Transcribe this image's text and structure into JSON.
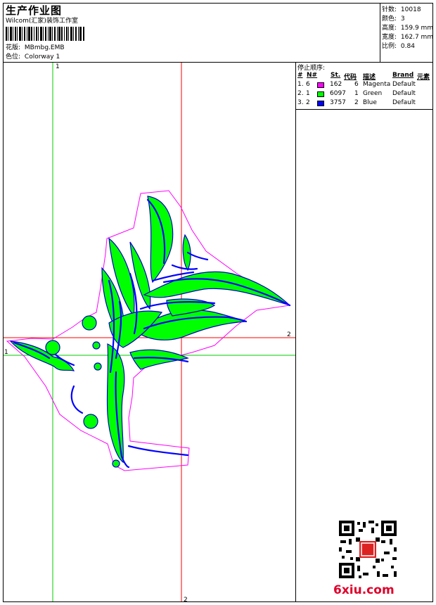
{
  "header": {
    "title": "生产作业图",
    "company": "Wilcom(汇家)装饰工作室",
    "design_label": "花版:",
    "design_value": "MBmbg.EMB",
    "colorway_label": "色位:",
    "colorway_value": "Colorway 1"
  },
  "stats": [
    {
      "label": "针数:",
      "value": "10018"
    },
    {
      "label": "颜色:",
      "value": "3"
    },
    {
      "label": "高度:",
      "value": "159.9 mm"
    },
    {
      "label": "宽度:",
      "value": "162.7 mm"
    },
    {
      "label": "比例:",
      "value": "0.84"
    }
  ],
  "stop_sequence": {
    "title": "停止顺序:",
    "columns": [
      "#",
      "N#",
      "St.",
      "代码",
      "描述",
      "Brand",
      "元素"
    ],
    "rows": [
      {
        "index": "1.",
        "n": "6",
        "color": "#ff00ff",
        "stitches": "162",
        "code": "6",
        "desc": "Magenta",
        "brand": "Default"
      },
      {
        "index": "2.",
        "n": "1",
        "color": "#00ff00",
        "stitches": "6097",
        "code": "1",
        "desc": "Green",
        "brand": "Default"
      },
      {
        "index": "3.",
        "n": "2",
        "color": "#0000ff",
        "stitches": "3757",
        "code": "2",
        "desc": "Blue",
        "brand": "Default"
      }
    ]
  },
  "axes": {
    "green_v": "1",
    "green_h": "1",
    "red_h": "2",
    "red_v": "2"
  },
  "watermark": "6xiu.com",
  "colors": {
    "magenta": "#ff00ff",
    "green": "#00ff00",
    "blue": "#0000ff",
    "guide_green": "#00cc00",
    "guide_red": "#ff0000"
  }
}
